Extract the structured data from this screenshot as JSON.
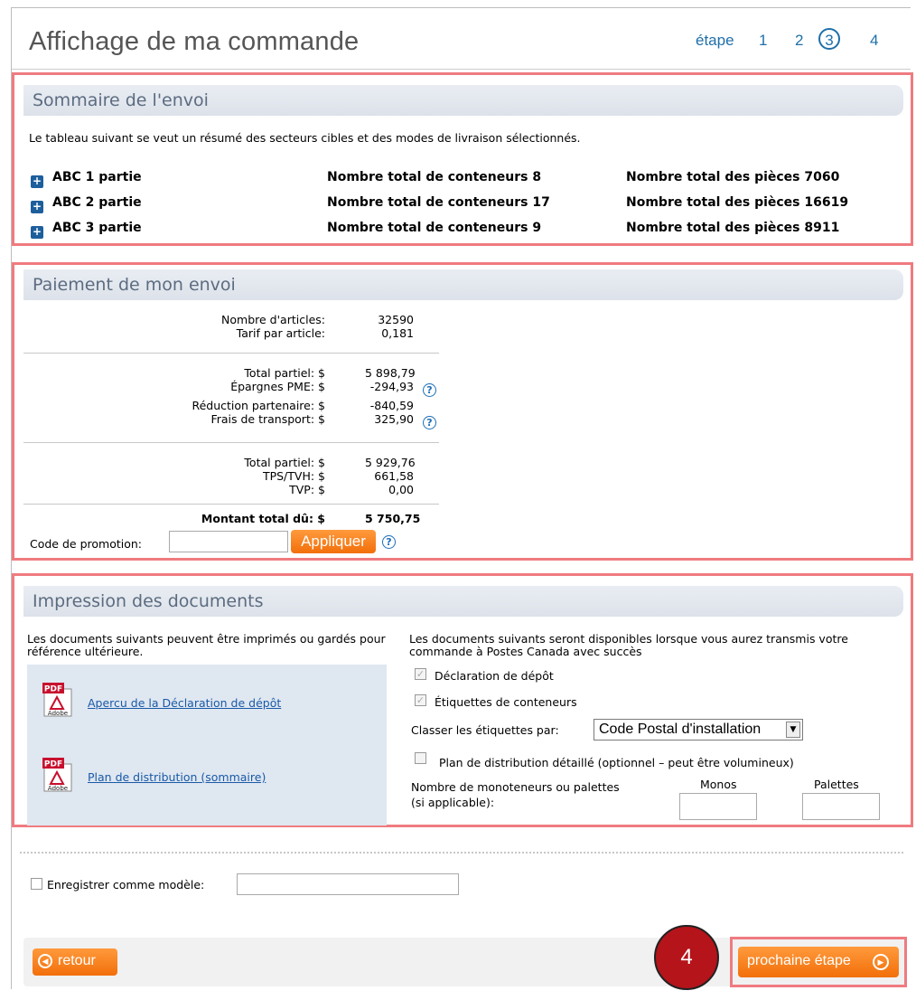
{
  "header": {
    "title": "Affichage de ma commande",
    "step_label": "étape",
    "steps": [
      "1",
      "2",
      "3",
      "4"
    ],
    "current_step": "3"
  },
  "summary": {
    "heading": "Sommaire de l'envoi",
    "intro": "Le tableau suivant se veut un résumé des secteurs cibles et des modes de livraison sélectionnés.",
    "rows": [
      {
        "name": "ABC 1 partie",
        "containers": "Nombre total de conteneurs 8",
        "pieces": "Nombre total des pièces 7060"
      },
      {
        "name": "ABC 2 partie",
        "containers": "Nombre total de conteneurs 17",
        "pieces": "Nombre total des pièces 16619"
      },
      {
        "name": "ABC 3 partie",
        "containers": "Nombre total de conteneurs 9",
        "pieces": "Nombre total des pièces 8911"
      }
    ]
  },
  "payment": {
    "heading": "Paiement de mon envoi",
    "items_label": "Nombre d'articles:",
    "items_value": "32590",
    "rate_label": "Tarif par article:",
    "rate_value": "0,181",
    "subtotal1_label": "Total partiel: $",
    "subtotal1_value": "5 898,79",
    "savings_label": "Épargnes PME: $",
    "savings_value": "-294,93",
    "partner_label": "Réduction partenaire: $",
    "partner_value": "-840,59",
    "transport_label": "Frais de transport: $",
    "transport_value": "325,90",
    "subtotal2_label": "Total partiel: $",
    "subtotal2_value": "5 929,76",
    "tps_label": "TPS/TVH: $",
    "tps_value": "661,58",
    "tvp_label": "TVP: $",
    "tvp_value": "0,00",
    "total_label": "Montant total dû: $",
    "total_value": "5 750,75",
    "promo_label": "Code de promotion:",
    "promo_value": "",
    "apply_button": "Appliquer",
    "help_glyph": "?"
  },
  "documents": {
    "heading": "Impression des documents",
    "left_intro": "Les documents suivants peuvent être imprimés ou gardés pour référence ultérieure.",
    "links": [
      "Apercu de la Déclaration de dépôt",
      "Plan de distribution (sommaire)"
    ],
    "pdf_label": "PDF",
    "adobe_label": "Adobe",
    "right_intro": "Les documents suivants seront disponibles lorsque vous aurez transmis votre commande à Postes Canada avec succès",
    "checkbox_deposit": "Déclaration de dépôt",
    "checkbox_labels": "Étiquettes de conteneurs",
    "sort_label": "Classer les étiquettes par:",
    "sort_value": "Code Postal d'installation",
    "detailed_plan": "Plan de distribution détaillé (optionnel – peut être volumineux)",
    "monos_label_line1": "Nombre de monoteneurs ou palettes",
    "monos_label_line2": "(si applicable):",
    "monos_header": "Monos",
    "palettes_header": "Palettes"
  },
  "footer": {
    "save_template_label": "Enregistrer comme modèle:",
    "save_template_value": "",
    "back_button": "retour",
    "next_button": "prochaine étape",
    "badge_number": "4"
  },
  "colors": {
    "accent_orange": "#f26f0a",
    "link_blue": "#1a5aa6",
    "highlight_red": "#ef7b80",
    "badge_red": "#b4141a"
  }
}
